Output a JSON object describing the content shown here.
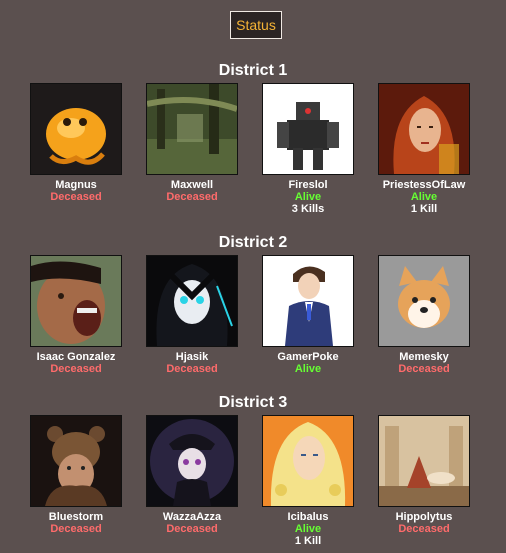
{
  "header": {
    "status_label": "Status"
  },
  "colors": {
    "deceased": "#ff6b6b",
    "alive": "#66ff33",
    "accent": "#f5b335"
  },
  "districts": [
    {
      "title": "District 1",
      "tributes": [
        {
          "name": "Magnus",
          "status": "Deceased",
          "kills": "",
          "icon": "orange-slime-avatar"
        },
        {
          "name": "Maxwell",
          "status": "Deceased",
          "kills": "",
          "icon": "swamp-forest-avatar"
        },
        {
          "name": "Fireslol",
          "status": "Alive",
          "kills": "3 Kills",
          "icon": "armored-robot-avatar"
        },
        {
          "name": "PriestessOfLaw",
          "status": "Alive",
          "kills": "1 Kill",
          "icon": "red-haired-woman-avatar"
        }
      ]
    },
    {
      "title": "District 2",
      "tributes": [
        {
          "name": "Isaac Gonzalez",
          "status": "Deceased",
          "kills": "",
          "icon": "screaming-man-avatar"
        },
        {
          "name": "Hjasik",
          "status": "Deceased",
          "kills": "",
          "icon": "anime-girl-avatar"
        },
        {
          "name": "GamerPoke",
          "status": "Alive",
          "kills": "",
          "icon": "anime-suit-man-avatar"
        },
        {
          "name": "Memesky",
          "status": "Deceased",
          "kills": "",
          "icon": "shiba-dog-avatar"
        }
      ]
    },
    {
      "title": "District 3",
      "tributes": [
        {
          "name": "Bluestorm",
          "status": "Deceased",
          "kills": "",
          "icon": "bear-warrior-avatar"
        },
        {
          "name": "WazzaAzza",
          "status": "Deceased",
          "kills": "",
          "icon": "anime-officer-avatar"
        },
        {
          "name": "Icibalus",
          "status": "Alive",
          "kills": "1 Kill",
          "icon": "blonde-anime-avatar"
        },
        {
          "name": "Hippolytus",
          "status": "Deceased",
          "kills": "",
          "icon": "classical-painting-avatar"
        }
      ]
    }
  ]
}
